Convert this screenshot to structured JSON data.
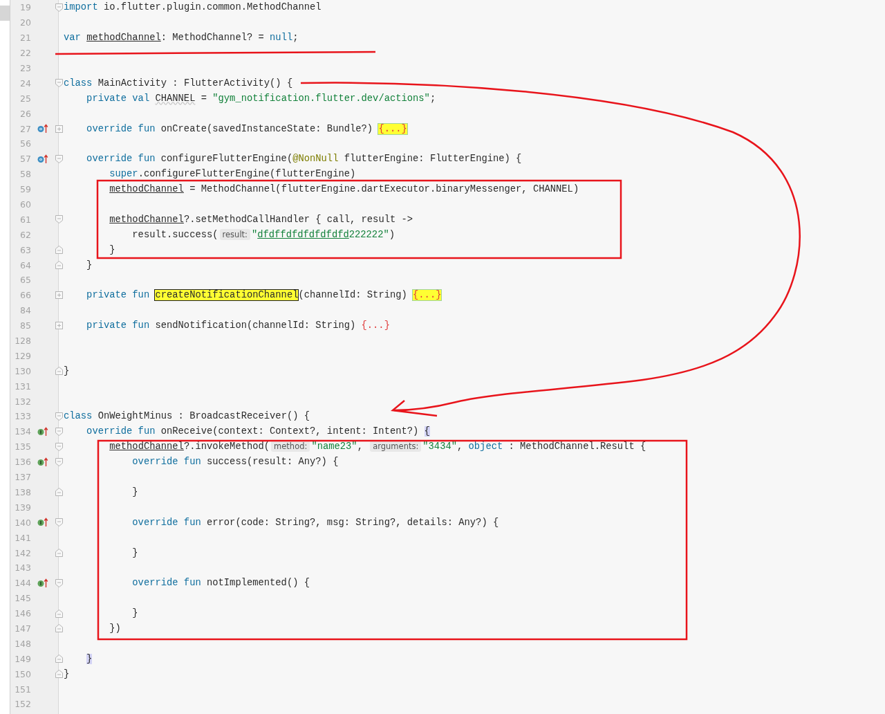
{
  "editor": {
    "lines": [
      {
        "number": "19",
        "expanded": true,
        "tokens": [
          {
            "kind": "kw",
            "text": "import"
          },
          {
            "kind": "plain",
            "text": " io.flutter.plugin.common.MethodChannel"
          }
        ]
      },
      {
        "number": "20"
      },
      {
        "number": "21",
        "tokens": [
          {
            "kind": "kw",
            "text": "var "
          },
          {
            "kind": "ul",
            "text": "methodChannel"
          },
          {
            "kind": "plain",
            "text": ": MethodChannel? = "
          },
          {
            "kind": "kw",
            "text": "null"
          },
          {
            "kind": "plain",
            "text": ";"
          }
        ]
      },
      {
        "number": "22"
      },
      {
        "number": "23"
      },
      {
        "number": "24",
        "expanded": true,
        "tokens": [
          {
            "kind": "kw",
            "text": "class"
          },
          {
            "kind": "plain",
            "text": " MainActivity : FlutterActivity() {"
          }
        ],
        "children": [
          {
            "number": "25",
            "tokens": [
              {
                "kind": "kw",
                "text": "private val "
              },
              {
                "kind": "wavy",
                "text": "CHANNEL"
              },
              {
                "kind": "plain",
                "text": " = "
              },
              {
                "kind": "str",
                "text": "\"gym_notification.flutter.dev/actions\""
              },
              {
                "kind": "plain",
                "text": ";"
              }
            ]
          },
          {
            "number": "26"
          },
          {
            "number": "27",
            "overrides": true,
            "expanded": false,
            "tokens": [
              {
                "kind": "kw",
                "text": "override fun "
              },
              {
                "kind": "plain",
                "text": "onCreate(savedInstanceState: Bundle?) "
              },
              {
                "kind": "folded-hl",
                "text": "{...}"
              }
            ]
          },
          {
            "number": "56"
          },
          {
            "number": "57",
            "overrides": true,
            "expanded": true,
            "tokens": [
              {
                "kind": "kw",
                "text": "override fun "
              },
              {
                "kind": "plain",
                "text": "configureFlutterEngine("
              },
              {
                "kind": "ann",
                "text": "@NonNull"
              },
              {
                "kind": "plain",
                "text": " flutterEngine: FlutterEngine) {"
              }
            ],
            "children": [
              {
                "number": "58",
                "tokens": [
                  {
                    "kind": "kw",
                    "text": "super"
                  },
                  {
                    "kind": "plain",
                    "text": ".configureFlutterEngine(flutterEngine)"
                  }
                ]
              },
              {
                "number": "59",
                "tokens": [
                  {
                    "kind": "ul",
                    "text": "methodChannel"
                  },
                  {
                    "kind": "plain",
                    "text": " = MethodChannel(flutterEngine.dartExecutor.binaryMessenger, CHANNEL)"
                  }
                ]
              },
              {
                "number": "60"
              },
              {
                "number": "61",
                "expanded": true,
                "tokens": [
                  {
                    "kind": "ul",
                    "text": "methodChannel"
                  },
                  {
                    "kind": "plain",
                    "text": "?.setMethodCallHandler { call, result ->"
                  }
                ],
                "children": [
                  {
                    "number": "62",
                    "tokens": [
                      {
                        "kind": "plain",
                        "text": "result.success("
                      },
                      {
                        "kind": "hint",
                        "text": "result:"
                      },
                      {
                        "kind": "str",
                        "text": "\""
                      },
                      {
                        "kind": "str-ul",
                        "text": "dfdffdfdfdfdfdfd"
                      },
                      {
                        "kind": "str",
                        "text": "222222\""
                      },
                      {
                        "kind": "plain",
                        "text": ")"
                      }
                    ]
                  }
                ]
              },
              {
                "number": "63",
                "block_end": true,
                "tokens": [
                  {
                    "kind": "plain",
                    "text": "}"
                  }
                ]
              }
            ]
          },
          {
            "number": "64",
            "block_end": true,
            "tokens": [
              {
                "kind": "plain",
                "text": "}"
              }
            ]
          },
          {
            "number": "65"
          },
          {
            "number": "66",
            "expanded": false,
            "tokens": [
              {
                "kind": "kw",
                "text": "private fun "
              },
              {
                "kind": "match",
                "text": "createNotificationChannel"
              },
              {
                "kind": "plain",
                "text": "(channelId: String) "
              },
              {
                "kind": "folded-hl",
                "text": "{...}"
              }
            ]
          },
          {
            "number": "84"
          },
          {
            "number": "85",
            "expanded": false,
            "tokens": [
              {
                "kind": "kw",
                "text": "private fun "
              },
              {
                "kind": "plain",
                "text": "sendNotification(channelId: String) "
              },
              {
                "kind": "folded",
                "text": "{...}"
              }
            ]
          },
          {
            "number": "128"
          },
          {
            "number": "129"
          }
        ]
      },
      {
        "number": "130",
        "block_end": true,
        "tokens": [
          {
            "kind": "plain",
            "text": "}"
          }
        ]
      },
      {
        "number": "131"
      },
      {
        "number": "132"
      },
      {
        "number": "133",
        "expanded": true,
        "tokens": [
          {
            "kind": "kw",
            "text": "class"
          },
          {
            "kind": "plain",
            "text": " OnWeightMinus : BroadcastReceiver() {"
          }
        ],
        "children": [
          {
            "number": "134",
            "implements": true,
            "expanded": true,
            "tokens": [
              {
                "kind": "kw",
                "text": "override fun "
              },
              {
                "kind": "plain",
                "text": "onReceive(context: Context?, intent: Intent?) "
              },
              {
                "kind": "brace",
                "text": "{"
              }
            ],
            "children": [
              {
                "number": "135",
                "expanded": true,
                "tokens": [
                  {
                    "kind": "ul",
                    "text": "methodChannel"
                  },
                  {
                    "kind": "plain",
                    "text": "?.invokeMethod("
                  },
                  {
                    "kind": "hint",
                    "text": "method:"
                  },
                  {
                    "kind": "str",
                    "text": "\"name23\""
                  },
                  {
                    "kind": "plain",
                    "text": ", "
                  },
                  {
                    "kind": "hint",
                    "text": "arguments:"
                  },
                  {
                    "kind": "str",
                    "text": "\"3434\""
                  },
                  {
                    "kind": "plain",
                    "text": ", "
                  },
                  {
                    "kind": "kw",
                    "text": "object"
                  },
                  {
                    "kind": "plain",
                    "text": " : MethodChannel.Result {"
                  }
                ],
                "children": [
                  {
                    "number": "136",
                    "implements": true,
                    "expanded": true,
                    "tokens": [
                      {
                        "kind": "kw",
                        "text": "override fun "
                      },
                      {
                        "kind": "plain",
                        "text": "success(result: Any?) {"
                      }
                    ]
                  },
                  {
                    "number": "137"
                  },
                  {
                    "number": "138",
                    "block_end": true,
                    "tokens": [
                      {
                        "kind": "plain",
                        "text": "}"
                      }
                    ]
                  },
                  {
                    "number": "139"
                  },
                  {
                    "number": "140",
                    "implements": true,
                    "expanded": true,
                    "tokens": [
                      {
                        "kind": "kw",
                        "text": "override fun "
                      },
                      {
                        "kind": "plain",
                        "text": "error(code: String?, msg: String?, details: Any?) {"
                      }
                    ]
                  },
                  {
                    "number": "141"
                  },
                  {
                    "number": "142",
                    "block_end": true,
                    "tokens": [
                      {
                        "kind": "plain",
                        "text": "}"
                      }
                    ]
                  },
                  {
                    "number": "143"
                  },
                  {
                    "number": "144",
                    "implements": true,
                    "expanded": true,
                    "tokens": [
                      {
                        "kind": "kw",
                        "text": "override fun "
                      },
                      {
                        "kind": "plain",
                        "text": "notImplemented() {"
                      }
                    ]
                  },
                  {
                    "number": "145"
                  },
                  {
                    "number": "146",
                    "block_end": true,
                    "tokens": [
                      {
                        "kind": "plain",
                        "text": "}"
                      }
                    ]
                  }
                ]
              },
              {
                "number": "147",
                "block_end": true,
                "tokens": [
                  {
                    "kind": "plain",
                    "text": "})"
                  }
                ]
              },
              {
                "number": "148"
              }
            ]
          },
          {
            "number": "149",
            "block_end": true,
            "tokens": [
              {
                "kind": "brace",
                "text": "}"
              }
            ]
          }
        ]
      },
      {
        "number": "150",
        "block_end": true,
        "tokens": [
          {
            "kind": "plain",
            "text": "}"
          }
        ]
      },
      {
        "number": "151"
      },
      {
        "number": "152"
      }
    ]
  }
}
